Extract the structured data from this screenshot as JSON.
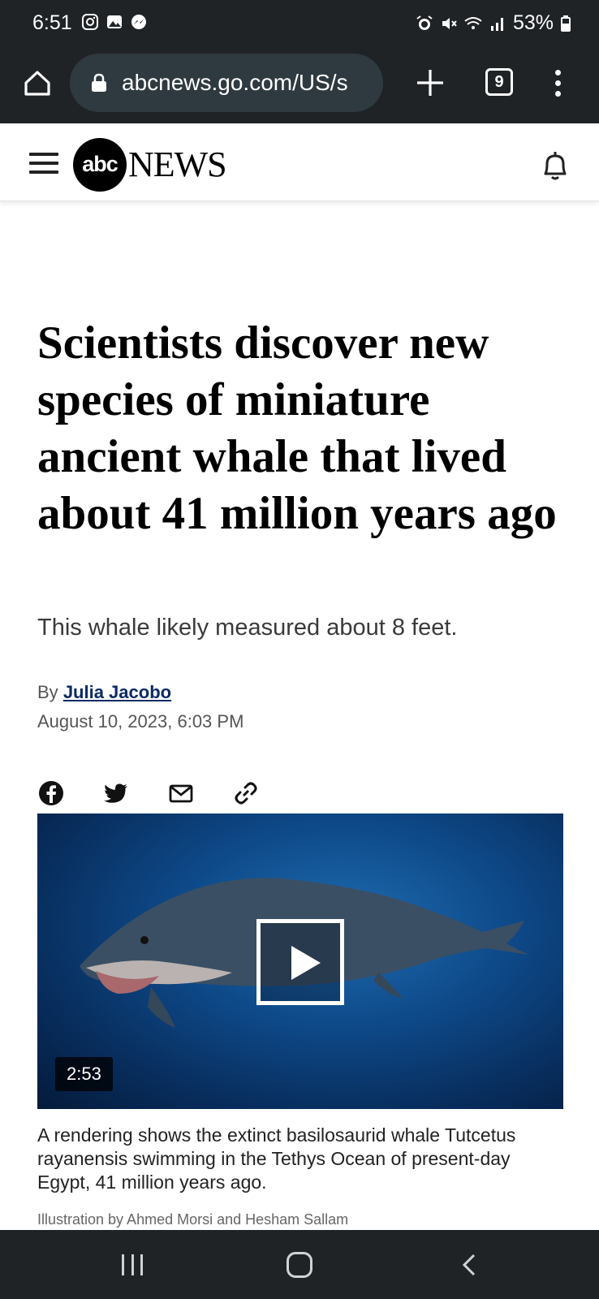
{
  "status_bar": {
    "time": "6:51",
    "battery": "53%"
  },
  "browser": {
    "url": "abcnews.go.com/US/s",
    "tab_count": "9"
  },
  "site": {
    "logo_abc": "abc",
    "logo_news": "NEWS"
  },
  "article": {
    "headline": "Scientists discover new species of miniature ancient whale that lived about 41 million years ago",
    "dek": "This whale likely measured about 8 feet.",
    "byline_prefix": "By",
    "author": "Julia Jacobo",
    "date": "August 10, 2023, 6:03 PM",
    "share_icons": [
      "facebook-icon",
      "twitter-icon",
      "email-icon",
      "link-icon"
    ],
    "video": {
      "duration": "2:53"
    },
    "caption": "A rendering shows the extinct basilosaurid whale Tutcetus rayanensis swimming in the Tethys Ocean of present-day Egypt, 41 million years ago.",
    "credit": "Illustration by Ahmed Morsi and Hesham Sallam"
  },
  "colors": {
    "chrome": "#1f2326",
    "author_link": "#0a2a63"
  }
}
